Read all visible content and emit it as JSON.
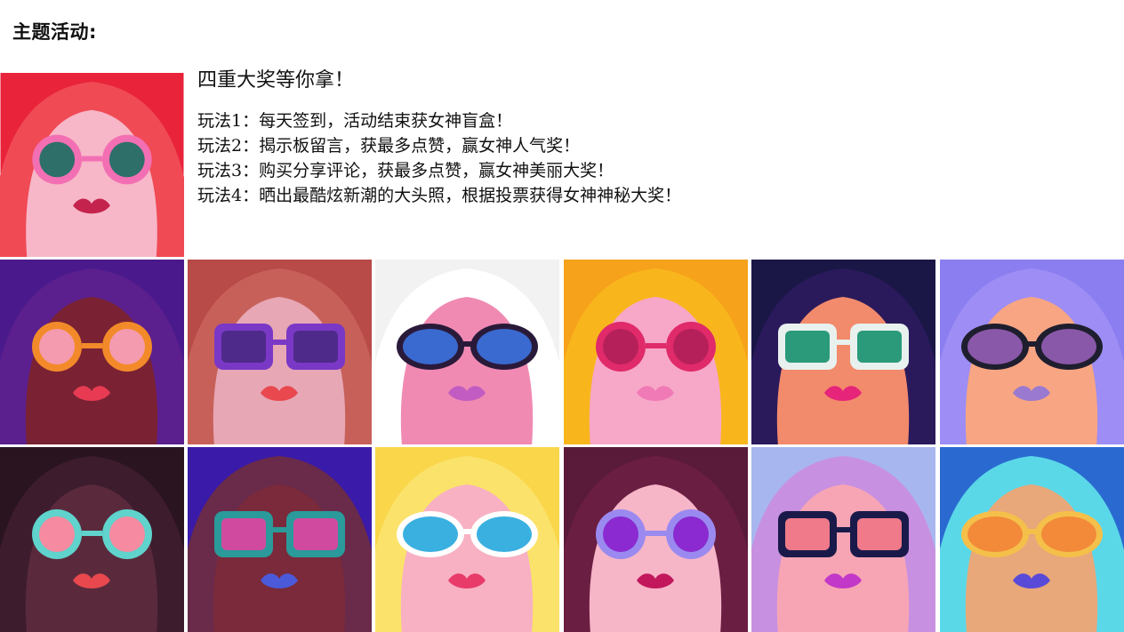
{
  "page": {
    "heading": "主题活动:"
  },
  "promo": {
    "title": "四重大奖等你拿！",
    "rules": [
      "玩法1：每天签到，活动结束获女神盲盒！",
      "玩法2：揭示板留言，获最多点赞，赢女神人气奖！",
      "玩法3：购买分享评论，获最多点赞，赢女神美丽大奖！",
      "玩法4：晒出最酷炫新潮的大头照，根据投票获得女神神秘大奖！"
    ]
  },
  "feature_image": {
    "icon": "goddess-portrait-pink-flower-glasses",
    "colors": {
      "bg": "#e8233a",
      "hair": "#f04a55",
      "skin": "#f7b7c8",
      "frame": "#f36fb4",
      "lens": "#2e6f6a",
      "lips": "#c4234d"
    }
  },
  "gallery": [
    {
      "name": "portrait-orange-round-glasses",
      "colors": {
        "bg": "#4a1a8c",
        "hair": "#5b1f8e",
        "skin": "#7a2233",
        "frame": "#f28a2a",
        "lens": "#f59bb0",
        "lips": "#e83b53"
      }
    },
    {
      "name": "portrait-purple-square-glasses",
      "colors": {
        "bg": "#b84a48",
        "hair": "#c8605a",
        "skin": "#e7a7b5",
        "frame": "#7a38c6",
        "lens": "#4e2a8a",
        "lips": "#e8484e"
      }
    },
    {
      "name": "portrait-white-hair-blue-lenses",
      "colors": {
        "bg": "#f2f2f2",
        "hair": "#ffffff",
        "skin": "#f08ab3",
        "frame": "#2a1a3a",
        "lens": "#3a6ad0",
        "lips": "#c25cc2"
      }
    },
    {
      "name": "portrait-yellow-hair-cateye",
      "colors": {
        "bg": "#f6a21a",
        "hair": "#f8b61c",
        "skin": "#f7a7c8",
        "frame": "#e02a6a",
        "lens": "#b5205a",
        "lips": "#f07ab5"
      }
    },
    {
      "name": "portrait-dark-navy-green-lenses",
      "colors": {
        "bg": "#1a1747",
        "hair": "#2a1a5c",
        "skin": "#f28a6c",
        "frame": "#e8f1ee",
        "lens": "#2a9a7a",
        "lips": "#e6257a"
      }
    },
    {
      "name": "portrait-lilac-hair-dark-lenses",
      "colors": {
        "bg": "#8a7ef0",
        "hair": "#9d8df5",
        "skin": "#f7a582",
        "frame": "#1e1e2e",
        "lens": "#8a58a8",
        "lips": "#9a7ad0"
      }
    },
    {
      "name": "portrait-dark-hair-teal-glasses",
      "colors": {
        "bg": "#2a1420",
        "hair": "#3d1c2e",
        "skin": "#5a2a3c",
        "frame": "#5fd3cc",
        "lens": "#f58aa0",
        "lips": "#e8484e"
      }
    },
    {
      "name": "portrait-sunset-shield-glasses",
      "colors": {
        "bg": "#3a1aa8",
        "hair": "#6a2a4a",
        "skin": "#7a2a3a",
        "frame": "#2a9a9a",
        "lens": "#d04aa0",
        "lips": "#4a5ad8"
      }
    },
    {
      "name": "portrait-blonde-white-glasses",
      "colors": {
        "bg": "#f9d64a",
        "hair": "#fbe26a",
        "skin": "#f7b1c2",
        "frame": "#ffffff",
        "lens": "#3ab0e0",
        "lips": "#e83b6a"
      }
    },
    {
      "name": "portrait-maroon-violet-frames",
      "colors": {
        "bg": "#5a1a3a",
        "hair": "#6a1e42",
        "skin": "#f7b5c8",
        "frame": "#9a8af0",
        "lens": "#8a2ad0",
        "lips": "#c2185b"
      }
    },
    {
      "name": "portrait-flower-building-glasses",
      "colors": {
        "bg": "#a8b6f0",
        "hair": "#c890e0",
        "skin": "#f7a5b5",
        "frame": "#1a1a4a",
        "lens": "#f07a8a",
        "lips": "#c238c8"
      }
    },
    {
      "name": "portrait-tropical-square-glasses",
      "colors": {
        "bg": "#2a6ad0",
        "hair": "#5ad8e8",
        "skin": "#e8a87a",
        "frame": "#f5c04a",
        "lens": "#f28a3a",
        "lips": "#5a4ad8"
      }
    }
  ]
}
